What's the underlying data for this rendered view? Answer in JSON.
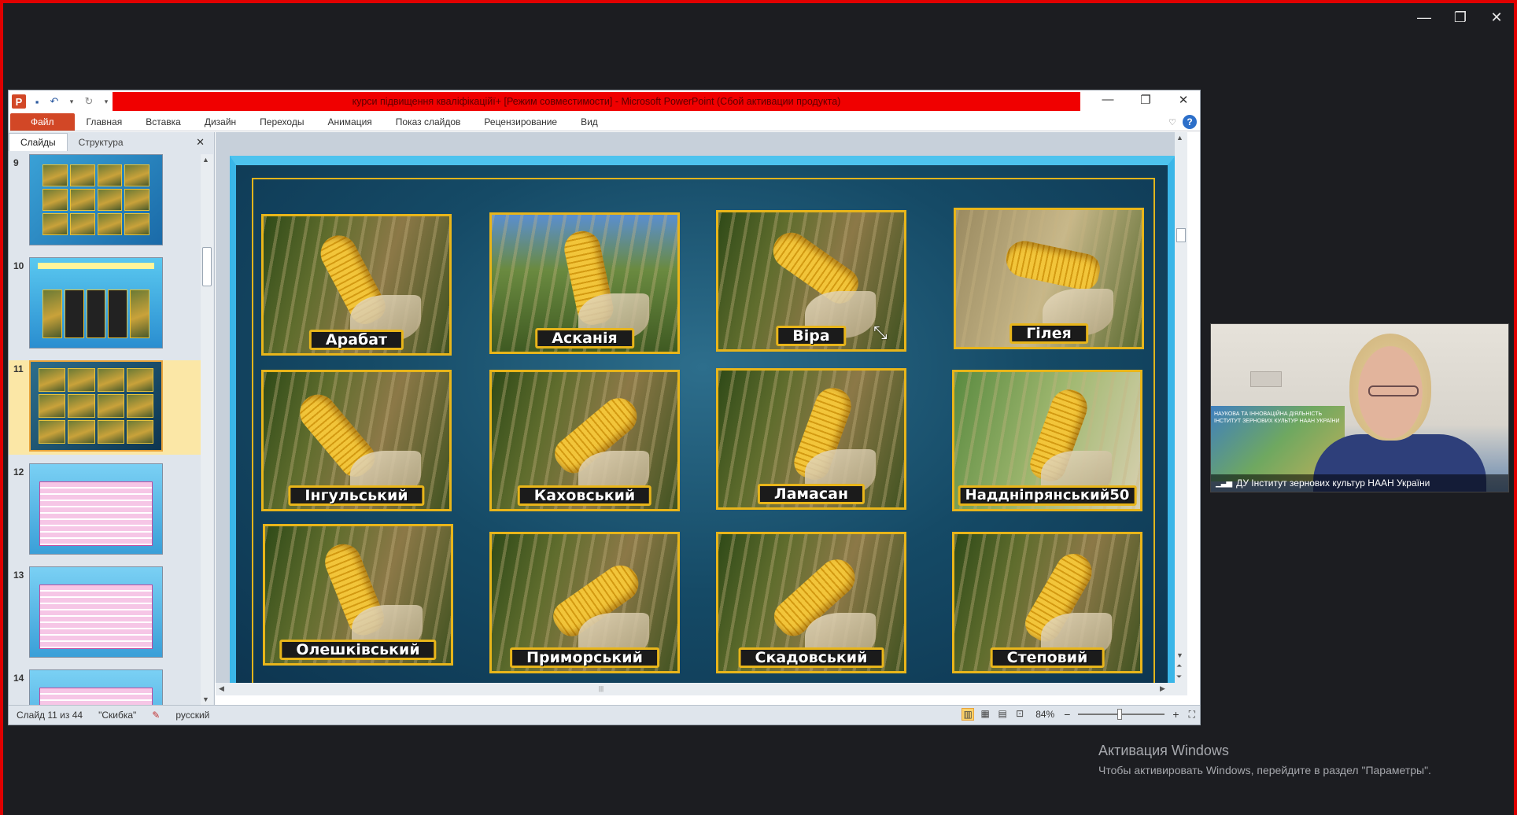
{
  "window": {
    "title": "курси підвищення кваліфікаційї+ [Режим совместимости]  -  Microsoft PowerPoint (Сбой активации продукта)",
    "app_icon": "P",
    "minimize": "—",
    "maximize": "❐",
    "close": "✕"
  },
  "host_controls": {
    "minimize": "—",
    "restore": "❐",
    "close": "✕"
  },
  "ribbon": {
    "file_tab": "Файл",
    "tabs": [
      "Главная",
      "Вставка",
      "Дизайн",
      "Переходы",
      "Анимация",
      "Показ слайдов",
      "Рецензирование",
      "Вид"
    ],
    "help": "?"
  },
  "left_pane": {
    "tabs": [
      "Слайды",
      "Структура"
    ],
    "close": "✕",
    "slides": [
      {
        "num": "9"
      },
      {
        "num": "10"
      },
      {
        "num": "11"
      },
      {
        "num": "12"
      },
      {
        "num": "13"
      },
      {
        "num": "14"
      }
    ]
  },
  "slide": {
    "varieties": [
      "Арабат",
      "Асканія",
      "Віра",
      "Гілея",
      "Інгульський",
      "Каховський",
      "Ламасан",
      "Наддніпрянський50",
      "Олешківський",
      "Приморський",
      "Скадовський",
      "Степовий"
    ]
  },
  "statusbar": {
    "slide_info": "Слайд 11 из 44",
    "theme": "\"Скибка\"",
    "language": "русский",
    "zoom": "84%",
    "zoom_out": "−",
    "zoom_in": "+"
  },
  "video": {
    "participant": "ДУ Інститут зернових культур НААН України",
    "map_text": "НАУКОВА ТА ІННОВАЦІЙНА ДІЯЛЬНІСТЬ ІНСТИТУТ ЗЕРНОВИХ КУЛЬТУР НААН УКРАЇНИ"
  },
  "activation": {
    "title": "Активация Windows",
    "subtitle": "Чтобы активировать Windows, перейдите в раздел \"Параметры\"."
  }
}
